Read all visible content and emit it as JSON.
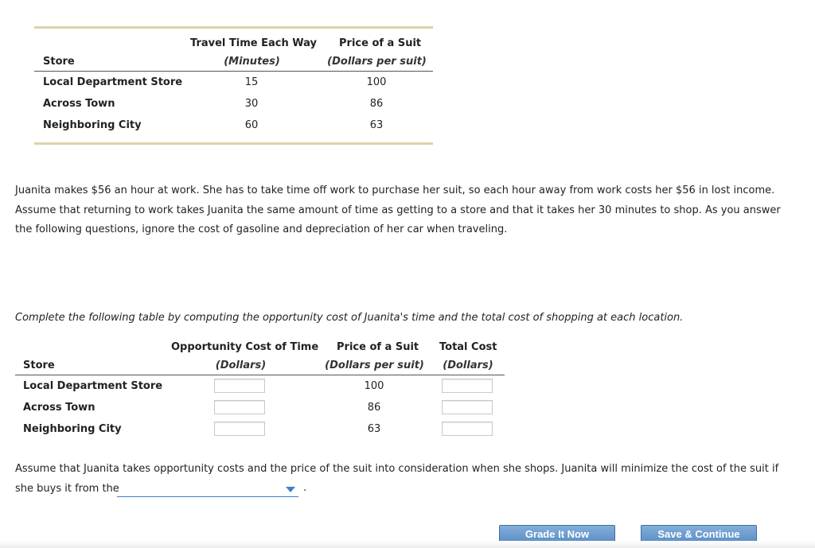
{
  "table1": {
    "headers": {
      "store": "Store",
      "travel": "Travel Time Each Way",
      "travel_unit": "(Minutes)",
      "price": "Price of a Suit",
      "price_unit": "(Dollars per suit)"
    },
    "rows": [
      {
        "store": "Local Department Store",
        "travel": "15",
        "price": "100"
      },
      {
        "store": "Across Town",
        "travel": "30",
        "price": "86"
      },
      {
        "store": "Neighboring City",
        "travel": "60",
        "price": "63"
      }
    ]
  },
  "paragraph": {
    "line1": "Juanita makes $56 an hour at work. She has to take time off work to purchase her suit, so each hour away from work costs her $56 in lost income.",
    "line2": "Assume that returning to work takes Juanita the same amount of time as getting to a store and that it takes her 30 minutes to shop. As you answer",
    "line3": "the following questions, ignore the cost of gasoline and depreciation of her car when traveling."
  },
  "instruction": "Complete the following table by computing the opportunity cost of Juanita's time and the total cost of shopping at each location.",
  "table2": {
    "headers": {
      "store": "Store",
      "opp": "Opportunity Cost of Time",
      "opp_unit": "(Dollars)",
      "price": "Price of a Suit",
      "price_unit": "(Dollars per suit)",
      "total": "Total Cost",
      "total_unit": "(Dollars)"
    },
    "rows": [
      {
        "store": "Local Department Store",
        "opp_value": "",
        "price": "100",
        "total_value": ""
      },
      {
        "store": "Across Town",
        "opp_value": "",
        "price": "86",
        "total_value": ""
      },
      {
        "store": "Neighboring City",
        "opp_value": "",
        "price": "63",
        "total_value": ""
      }
    ]
  },
  "question": {
    "line1": "Assume that Juanita takes opportunity costs and the price of the suit into consideration when she shops. Juanita will minimize the cost of the suit if",
    "line2_prefix": "she buys it from the",
    "line2_suffix": ".",
    "dropdown_value": ""
  },
  "buttons": {
    "grade": "Grade It Now",
    "save": "Save & Continue"
  },
  "colors": {
    "rule": "#dcd3aa",
    "button": "#6a9bd0",
    "dropdown_accent": "#3b82c8"
  }
}
